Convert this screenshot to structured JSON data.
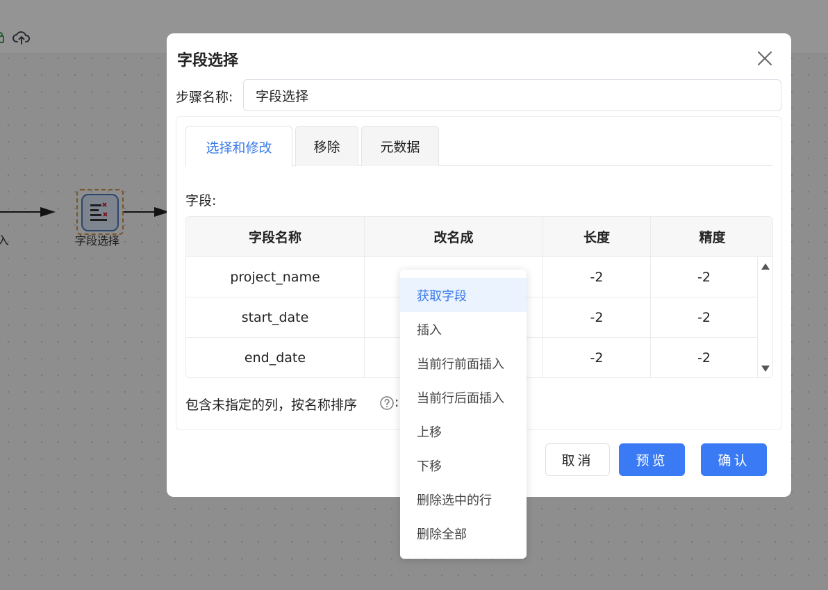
{
  "canvas": {
    "left_node_label": "入",
    "node_label": "字段选择"
  },
  "dialog": {
    "title": "字段选择",
    "step_name_label": "步骤名称:",
    "step_name_value": "字段选择",
    "tabs": [
      {
        "label": "选择和修改",
        "active": true
      },
      {
        "label": "移除",
        "active": false
      },
      {
        "label": "元数据",
        "active": false
      }
    ],
    "fields_label": "字段:",
    "table": {
      "headers": [
        "字段名称",
        "改名成",
        "长度",
        "精度"
      ],
      "rows": [
        {
          "name": "project_name",
          "rename": "",
          "length": "-2",
          "precision": "-2"
        },
        {
          "name": "start_date",
          "rename": "",
          "length": "-2",
          "precision": "-2"
        },
        {
          "name": "end_date",
          "rename": "",
          "length": "-2",
          "precision": "-2"
        }
      ]
    },
    "include_unspecified_label": "包含未指定的列，按名称排序",
    "include_colon": ":",
    "buttons": {
      "cancel": "取消",
      "preview": "预览",
      "confirm": "确认"
    }
  },
  "context_menu": {
    "items": [
      {
        "label": "获取字段",
        "hover": true
      },
      {
        "label": "插入",
        "hover": false
      },
      {
        "label": "当前行前面插入",
        "hover": false
      },
      {
        "label": "当前行后面插入",
        "hover": false
      },
      {
        "label": "上移",
        "hover": false
      },
      {
        "label": "下移",
        "hover": false
      },
      {
        "label": "删除选中的行",
        "hover": false
      },
      {
        "label": "删除全部",
        "hover": false
      }
    ]
  },
  "colors": {
    "primary": "#3a7bf5",
    "tab_active_text": "#3a7be8",
    "menu_hover_bg": "#ebf3fe"
  }
}
